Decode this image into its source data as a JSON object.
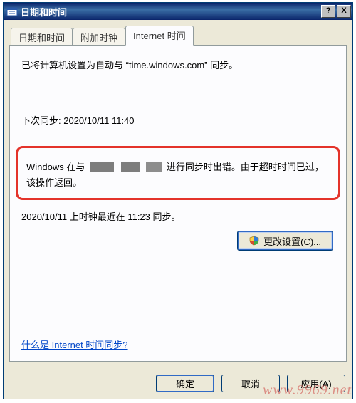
{
  "window": {
    "title": "日期和时间"
  },
  "titlebar_buttons": {
    "help": "?",
    "close": "X"
  },
  "tabs": {
    "datetime": "日期和时间",
    "additional": "附加时钟",
    "internet": "Internet 时间"
  },
  "body": {
    "sync_status_prefix": "已将计算机设置为自动与 “",
    "sync_server": "time.windows.com",
    "sync_status_suffix": "” 同步。",
    "next_sync_label": "下次同步: ",
    "next_sync_value": "2020/10/11 11:40",
    "error_prefix": "Windows 在与",
    "error_mid": "进行同步时出错。由于超时时间已过，该操作返回。",
    "last_sync": "2020/10/11 上时钟最近在 11:23 同步。",
    "change_button": "更改设置(C)...",
    "help_link": "什么是 Internet 时间同步?"
  },
  "dialog": {
    "ok": "确定",
    "cancel": "取消",
    "apply": "应用(A)"
  },
  "watermark": "www.9969.net"
}
